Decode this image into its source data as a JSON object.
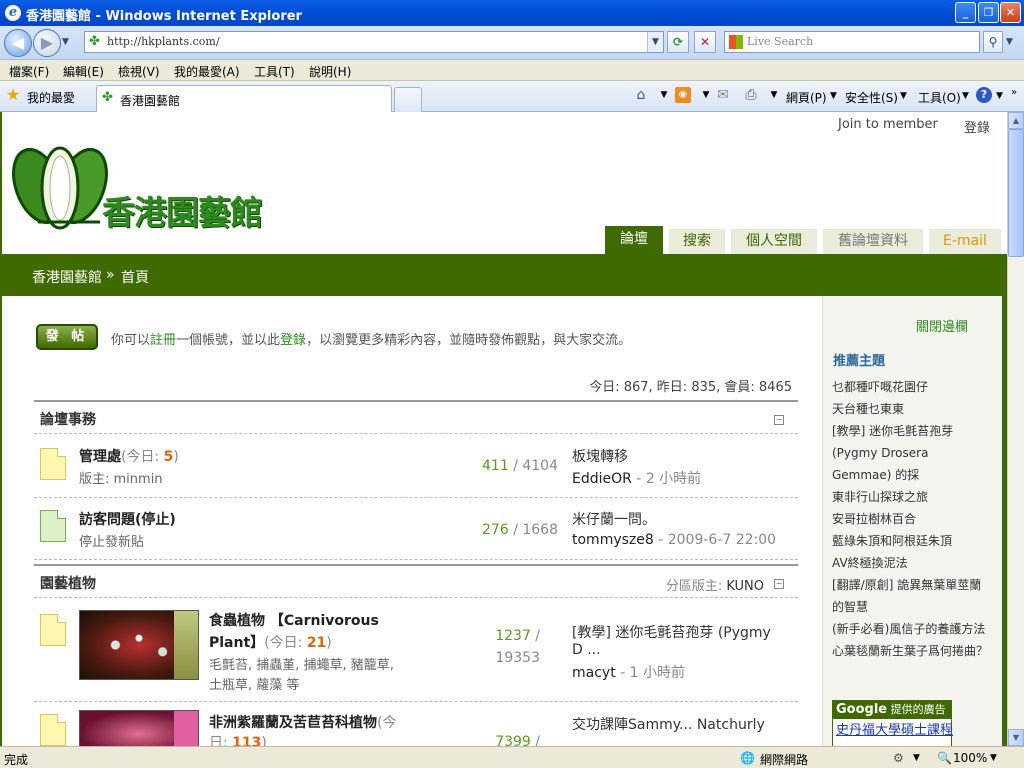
{
  "window": {
    "title": "香港園藝館 - Windows Internet Explorer"
  },
  "address": {
    "url": "http://hkplants.com/",
    "search_placeholder": "Live Search"
  },
  "menu": [
    "檔案(F)",
    "編輯(E)",
    "檢視(V)",
    "我的最愛(A)",
    "工具(T)",
    "說明(H)"
  ],
  "favbar": {
    "favorites_label": "我的最愛",
    "tab_title": "香港園藝館",
    "commands": {
      "page": "網頁(P)",
      "safety": "安全性(S)",
      "tools": "工具(O)"
    }
  },
  "site": {
    "join": "Join to member",
    "login": "登錄",
    "logo_text": "香港園藝館",
    "nav": [
      "論壇",
      "搜索",
      "個人空間",
      "舊論壇資料",
      "E-mail"
    ],
    "breadcrumb": {
      "home": "香港園藝館",
      "sep": "»",
      "current": "首頁"
    }
  },
  "main": {
    "post_button": "發 帖",
    "intro": {
      "a": "你可以",
      "register": "註冊",
      "b": "一個帳號，並以此",
      "login": "登錄",
      "c": "，以瀏覽更多精彩內容，並隨時發佈觀點，與大家交流。"
    },
    "stats": "今日: 867, 昨日: 835, 會員: 8465",
    "sections": [
      {
        "title": "論壇事務",
        "forums": [
          {
            "name": "管理處",
            "today_label": "(今日: ",
            "today": "5",
            "today_end": ")",
            "sub": "版主: minmin",
            "topics": "411",
            "posts": " / 4104",
            "last_title": "板塊轉移",
            "last_user": "EddieOR",
            "last_time": " - 2 小時前"
          },
          {
            "name": "訪客問題(停止)",
            "sub": "停止發新貼",
            "topics": "276",
            "posts": " / 1668",
            "last_title": "米仔蘭一問。",
            "last_user": "tommysze8",
            "last_time": " - 2009-6-7 22:00"
          }
        ]
      },
      {
        "title": "園藝植物",
        "moderator_label": "分區版主: ",
        "moderator": "KUNO",
        "forums": [
          {
            "name_line1": "食蟲植物 【Carnivorous",
            "name_line2": "Plant】",
            "today_label": "(今日: ",
            "today": "21",
            "today_end": ")",
            "sub_line1": "毛氈苔, 捕蟲堇, 捕蠅草, 豬籠草,",
            "sub_line2": "土瓶草, 蘿藻 等",
            "topics": "1237",
            "posts_line1": " /",
            "posts_line2": "19353",
            "last_title_line1": "[教學] 迷你毛氈苔孢芽 (Pygmy",
            "last_title_line2": "D ...",
            "last_user": "macyt",
            "last_time": " - 1 小時前"
          },
          {
            "name": "非洲紫羅蘭及苦苣苔科植物",
            "today_label": "(今",
            "today_line2": "日: ",
            "today": "113",
            "today_end": ")",
            "topics": "7399",
            "posts": " /",
            "last_title": "交功課陣Sammy... Natchurly"
          }
        ]
      }
    ]
  },
  "sidebar": {
    "close": "關閉邊欄",
    "title": "推薦主題",
    "items": [
      "乜都種吓嘅花園仔",
      "天台種乜東東",
      "[教學] 迷你毛氈苔孢芽",
      "(Pygmy Drosera",
      "Gemmae) 的採",
      "東非行山探球之旅",
      "安哥拉樹林百合",
      "藍綠朱頂和阿根廷朱頂",
      "AV終極換泥法",
      "[翻譯/原創] 詭異無葉單莖蘭",
      "的智慧",
      "(新手必看)風信子的養護方法",
      "心葉毯蘭新生葉子爲何捲曲？"
    ],
    "ad_header_brand": "Google",
    "ad_header_text": "提供的廣告",
    "ad_text": "史丹福大學碩士課程"
  },
  "statusbar": {
    "left": "完成",
    "zone": "網際網路",
    "zoom": "100%"
  }
}
